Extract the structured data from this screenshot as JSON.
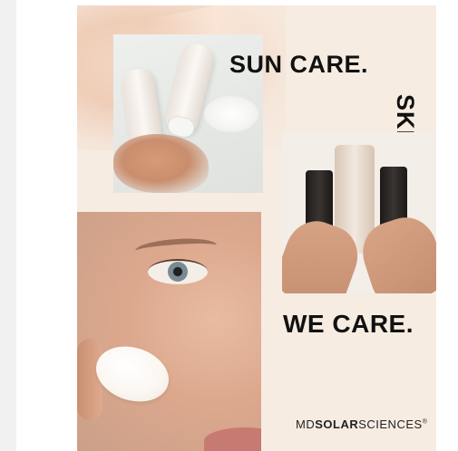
{
  "poster": {
    "headline_sun": "SUN CARE.",
    "headline_skin": "SKIN CARE.",
    "headline_we": "WE CARE.",
    "brand": {
      "part1": "MD",
      "part2": "SOLAR",
      "part3": "SCIENCES",
      "mark": "®"
    }
  },
  "colors": {
    "background": "#f7ece2",
    "text": "#111111"
  }
}
